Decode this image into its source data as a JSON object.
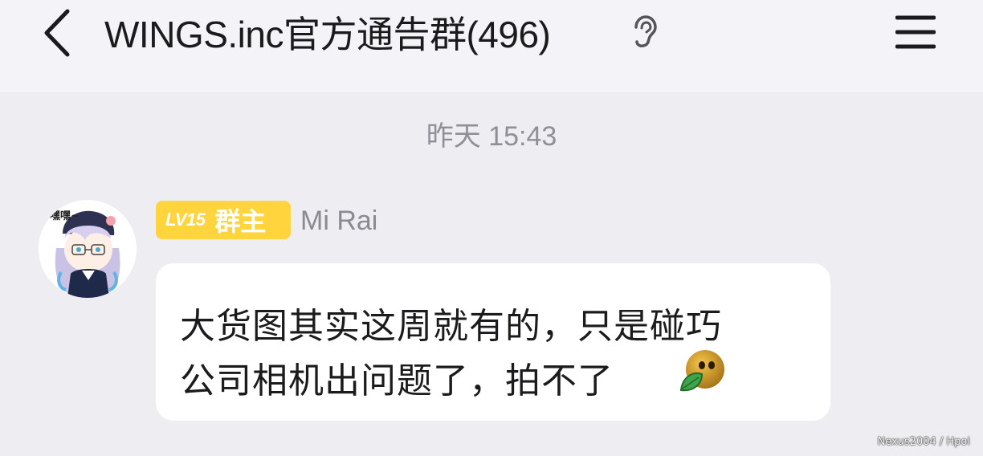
{
  "header": {
    "title": "WINGS.inc官方通告群(496)"
  },
  "chat": {
    "timestamp": "昨天 15:43",
    "messages": [
      {
        "badge_level": "LV15",
        "badge_role": "群主",
        "sender": "Mi Rai",
        "avatar_text": "嘿嘿~",
        "text_line1": "大货图其实这周就有的，只是碰巧",
        "text_line2": "公司相机出问题了，拍不了",
        "emoji": "face-covering-mouth-leaf-emoji"
      }
    ]
  },
  "watermark": "Nexus2004 / Hpoi",
  "colors": {
    "header_bg": "#f4f4f8",
    "chat_bg": "#ededf2",
    "badge": "#ffd43c",
    "bubble": "#ffffff"
  },
  "icons": [
    "back-arrow-icon",
    "ear-icon",
    "menu-icon"
  ]
}
